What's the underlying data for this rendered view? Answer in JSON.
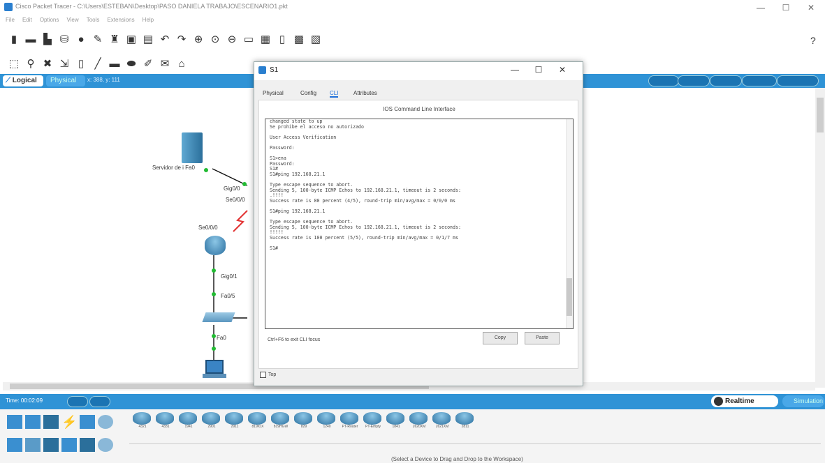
{
  "app": {
    "title": "Cisco Packet Tracer - C:\\Users\\ESTEBAN\\Desktop\\PASO DANIELA TRABAJO\\ESCENARIO1.pkt",
    "menu": [
      "File",
      "Edit",
      "Options",
      "View",
      "Tools",
      "Extensions",
      "Help"
    ],
    "help": "?"
  },
  "workspace": {
    "logical_tab": "Logical",
    "physical_tab": "Physical",
    "coords": "x: 388, y: 111",
    "devices": {
      "server_label": "Servidor de i Fa0",
      "gig00": "Gig0/0",
      "se000": "Se0/0/0",
      "se000b": "Se0/0/0",
      "gig01": "Gig0/1",
      "fa05": "Fa0/5",
      "fa0": "Fa0"
    }
  },
  "cli_window": {
    "title": "S1",
    "tabs": [
      "Physical",
      "Config",
      "CLI",
      "Attributes"
    ],
    "heading": "IOS Command Line Interface",
    "lines": [
      "changed state to up",
      "Se prohibe el acceso no autorizado",
      "",
      "User Access Verification",
      "",
      "Password:",
      "",
      "S1>ena",
      "Password:",
      "S1#",
      "S1#ping 192.168.21.1",
      "",
      "Type escape sequence to abort.",
      "Sending 5, 100-byte ICMP Echos to 192.168.21.1, timeout is 2 seconds:",
      ".!!!!",
      "Success rate is 80 percent (4/5), round-trip min/avg/max = 0/0/0 ms",
      "",
      "S1#ping 192.168.21.1",
      "",
      "Type escape sequence to abort.",
      "Sending 5, 100-byte ICMP Echos to 192.168.21.1, timeout is 2 seconds:",
      "!!!!!",
      "Success rate is 100 percent (5/5), round-trip min/avg/max = 0/1/7 ms",
      "",
      "S1#"
    ],
    "hint": "Ctrl+F6 to exit CLI focus",
    "copy": "Copy",
    "paste": "Paste",
    "top_label": "Top"
  },
  "simbar": {
    "time": "Time: 00:02:09",
    "realtime": "Realtime",
    "simulation": "Simulation"
  },
  "device_panel": {
    "hint": "(Select a Device to Drag and Drop to the Workspace)",
    "models": [
      "4321",
      "4331",
      "1941",
      "2901",
      "2911",
      "819IOX",
      "819HGW",
      "829",
      "1240",
      "PT-Router",
      "PT-Empty",
      "1841",
      "2620XM",
      "2621XM",
      "2811"
    ]
  }
}
